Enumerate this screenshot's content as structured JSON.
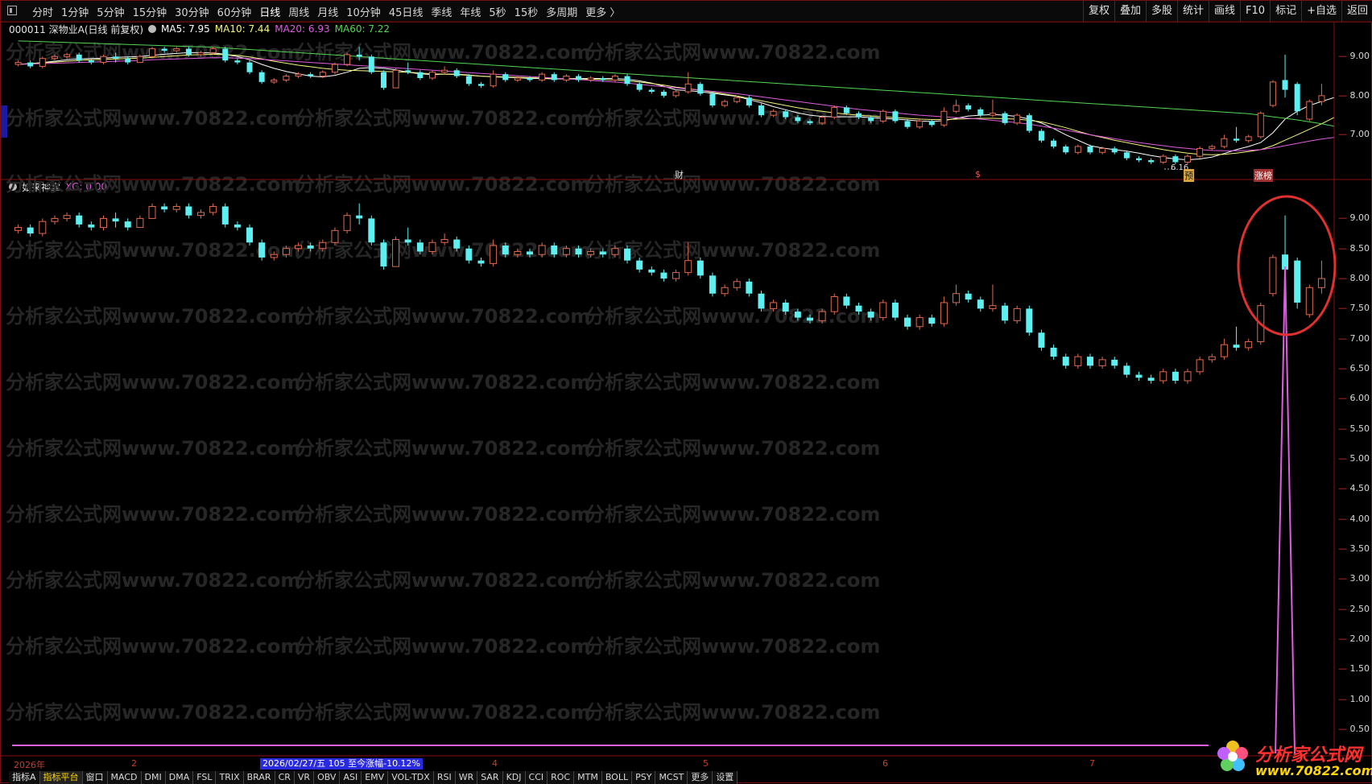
{
  "toolbar": {
    "periods": [
      "分时",
      "1分钟",
      "5分钟",
      "15分钟",
      "30分钟",
      "60分钟",
      "日线",
      "周线",
      "月线",
      "10分钟",
      "45日线",
      "季线",
      "年线",
      "5秒",
      "15秒",
      "多周期",
      "更多 〉"
    ],
    "active_period": "日线",
    "right_tools": [
      "复权",
      "叠加",
      "多股",
      "统计",
      "画线",
      "F10",
      "标记",
      "+自选",
      "返回"
    ]
  },
  "main_panel": {
    "stock": "000011 深物业A(日线 前复权)",
    "ma5_label": "MA5: 7.95",
    "ma10_label": "MA10: 7.44",
    "ma20_label": "MA20: 6.93",
    "ma60_label": "MA60: 7.22",
    "axis_labels": [
      "9.00",
      "8.00",
      "7.00"
    ],
    "markers": {
      "cai": "财",
      "dollar": "$",
      "low_price": "6.16",
      "yu": "预",
      "zhangbang": "涨榜"
    }
  },
  "indicator_panel": {
    "name": "如来神掌",
    "xg_label": "XG: 0.00",
    "axis_labels": [
      "9.00",
      "8.50",
      "8.00",
      "7.50",
      "7.00",
      "6.50",
      "6.00",
      "5.50",
      "5.00",
      "4.50",
      "4.00",
      "3.50",
      "3.00",
      "2.50",
      "2.00",
      "1.50",
      "1.00",
      "0.50"
    ]
  },
  "date_bar": {
    "year": "2026年",
    "month_2": "2",
    "range_label": "2026/02/27/五 105 至今涨幅-10.12%",
    "month_4": "4",
    "month_5": "5",
    "month_6": "6",
    "month_7": "7"
  },
  "indicator_tabs": [
    "指标A",
    "指标平台",
    "窗口",
    "MACD",
    "DMI",
    "DMA",
    "FSL",
    "TRIX",
    "BRAR",
    "CR",
    "VR",
    "OBV",
    "ASI",
    "EMV",
    "VOL-TDX",
    "RSI",
    "WR",
    "SAR",
    "KDJ",
    "CCI",
    "ROC",
    "MTM",
    "BOLL",
    "PSY",
    "MCST",
    "更多",
    "设置"
  ],
  "active_indicator_tab": "指标平台",
  "watermark": "分析家公式网www.70822.com",
  "corner_logo": {
    "brand": "分析家公式网",
    "url": "www.70822.com"
  },
  "colors": {
    "up": "#e06a50",
    "down": "#5ef0f0",
    "ma5": "#ffffff",
    "ma10": "#f5f57a",
    "ma20": "#e05ce0",
    "ma60": "#52d652",
    "axis": "#d33",
    "highlight_circle": "#e03030"
  },
  "chart_data": {
    "type": "candlestick",
    "candles": [
      [
        8.8,
        8.85,
        8.75,
        8.9
      ],
      [
        8.85,
        8.75,
        8.7,
        8.9
      ],
      [
        8.75,
        8.95,
        8.7,
        9.0
      ],
      [
        8.95,
        9.0,
        8.9,
        9.05
      ],
      [
        9.0,
        9.05,
        8.95,
        9.1
      ],
      [
        9.05,
        8.9,
        8.85,
        9.1
      ],
      [
        8.9,
        8.85,
        8.8,
        8.95
      ],
      [
        8.85,
        9.0,
        8.8,
        9.05
      ],
      [
        9.0,
        8.95,
        8.85,
        9.1
      ],
      [
        8.95,
        8.85,
        8.8,
        9.0
      ],
      [
        8.85,
        9.0,
        8.85,
        9.05
      ],
      [
        9.0,
        9.2,
        9.0,
        9.25
      ],
      [
        9.2,
        9.15,
        9.1,
        9.25
      ],
      [
        9.15,
        9.2,
        9.1,
        9.25
      ],
      [
        9.2,
        9.05,
        9.0,
        9.25
      ],
      [
        9.05,
        9.1,
        9.0,
        9.15
      ],
      [
        9.1,
        9.2,
        9.05,
        9.25
      ],
      [
        9.2,
        8.9,
        8.85,
        9.25
      ],
      [
        8.9,
        8.85,
        8.8,
        8.95
      ],
      [
        8.85,
        8.6,
        8.55,
        8.9
      ],
      [
        8.6,
        8.35,
        8.3,
        8.65
      ],
      [
        8.35,
        8.4,
        8.3,
        8.45
      ],
      [
        8.4,
        8.5,
        8.35,
        8.55
      ],
      [
        8.5,
        8.55,
        8.45,
        8.6
      ],
      [
        8.55,
        8.5,
        8.45,
        8.6
      ],
      [
        8.5,
        8.6,
        8.45,
        8.65
      ],
      [
        8.6,
        8.8,
        8.55,
        8.85
      ],
      [
        8.8,
        9.05,
        8.75,
        9.1
      ],
      [
        9.05,
        9.0,
        8.9,
        9.25
      ],
      [
        9.0,
        8.6,
        8.55,
        9.05
      ],
      [
        8.6,
        8.2,
        8.15,
        8.65
      ],
      [
        8.2,
        8.65,
        8.2,
        8.7
      ],
      [
        8.65,
        8.6,
        8.55,
        8.85
      ],
      [
        8.6,
        8.45,
        8.4,
        8.65
      ],
      [
        8.45,
        8.6,
        8.4,
        8.65
      ],
      [
        8.6,
        8.65,
        8.55,
        8.75
      ],
      [
        8.65,
        8.5,
        8.45,
        8.7
      ],
      [
        8.5,
        8.3,
        8.25,
        8.55
      ],
      [
        8.3,
        8.25,
        8.2,
        8.35
      ],
      [
        8.25,
        8.55,
        8.2,
        8.65
      ],
      [
        8.55,
        8.4,
        8.35,
        8.6
      ],
      [
        8.4,
        8.45,
        8.35,
        8.5
      ],
      [
        8.45,
        8.4,
        8.35,
        8.5
      ],
      [
        8.4,
        8.55,
        8.35,
        8.6
      ],
      [
        8.55,
        8.4,
        8.35,
        8.6
      ],
      [
        8.4,
        8.5,
        8.35,
        8.55
      ],
      [
        8.5,
        8.4,
        8.35,
        8.55
      ],
      [
        8.4,
        8.45,
        8.35,
        8.5
      ],
      [
        8.45,
        8.4,
        8.35,
        8.5
      ],
      [
        8.4,
        8.5,
        8.35,
        8.55
      ],
      [
        8.5,
        8.3,
        8.25,
        8.55
      ],
      [
        8.3,
        8.15,
        8.1,
        8.35
      ],
      [
        8.15,
        8.1,
        8.05,
        8.2
      ],
      [
        8.1,
        8.0,
        7.95,
        8.15
      ],
      [
        8.0,
        8.1,
        7.95,
        8.15
      ],
      [
        8.1,
        8.3,
        8.05,
        8.6
      ],
      [
        8.3,
        8.05,
        8.0,
        8.35
      ],
      [
        8.05,
        7.75,
        7.7,
        8.1
      ],
      [
        7.75,
        7.85,
        7.7,
        7.9
      ],
      [
        7.85,
        7.95,
        7.8,
        8.0
      ],
      [
        7.95,
        7.75,
        7.7,
        8.0
      ],
      [
        7.75,
        7.5,
        7.45,
        7.8
      ],
      [
        7.5,
        7.6,
        7.45,
        7.65
      ],
      [
        7.6,
        7.45,
        7.4,
        7.65
      ],
      [
        7.45,
        7.35,
        7.3,
        7.5
      ],
      [
        7.35,
        7.3,
        7.25,
        7.4
      ],
      [
        7.3,
        7.45,
        7.25,
        7.5
      ],
      [
        7.45,
        7.7,
        7.4,
        7.75
      ],
      [
        7.7,
        7.55,
        7.5,
        7.75
      ],
      [
        7.55,
        7.45,
        7.4,
        7.6
      ],
      [
        7.45,
        7.35,
        7.3,
        7.5
      ],
      [
        7.35,
        7.6,
        7.3,
        7.65
      ],
      [
        7.6,
        7.35,
        7.3,
        7.65
      ],
      [
        7.35,
        7.2,
        7.15,
        7.4
      ],
      [
        7.2,
        7.35,
        7.15,
        7.4
      ],
      [
        7.35,
        7.25,
        7.2,
        7.4
      ],
      [
        7.25,
        7.6,
        7.2,
        7.7
      ],
      [
        7.6,
        7.75,
        7.55,
        7.9
      ],
      [
        7.75,
        7.65,
        7.6,
        7.8
      ],
      [
        7.65,
        7.5,
        7.45,
        7.7
      ],
      [
        7.5,
        7.55,
        7.45,
        7.9
      ],
      [
        7.55,
        7.3,
        7.25,
        7.6
      ],
      [
        7.3,
        7.5,
        7.25,
        7.55
      ],
      [
        7.5,
        7.1,
        7.05,
        7.55
      ],
      [
        7.1,
        6.85,
        6.8,
        7.15
      ],
      [
        6.85,
        6.7,
        6.65,
        6.9
      ],
      [
        6.7,
        6.55,
        6.5,
        6.75
      ],
      [
        6.55,
        6.7,
        6.5,
        6.75
      ],
      [
        6.7,
        6.55,
        6.5,
        6.75
      ],
      [
        6.55,
        6.65,
        6.5,
        6.7
      ],
      [
        6.65,
        6.55,
        6.5,
        6.7
      ],
      [
        6.55,
        6.4,
        6.35,
        6.6
      ],
      [
        6.4,
        6.35,
        6.3,
        6.45
      ],
      [
        6.35,
        6.3,
        6.25,
        6.4
      ],
      [
        6.3,
        6.45,
        6.25,
        6.5
      ],
      [
        6.45,
        6.3,
        6.25,
        6.5
      ],
      [
        6.3,
        6.45,
        6.25,
        6.5
      ],
      [
        6.45,
        6.65,
        6.4,
        6.7
      ],
      [
        6.65,
        6.7,
        6.6,
        6.75
      ],
      [
        6.7,
        6.9,
        6.65,
        7.0
      ],
      [
        6.9,
        6.85,
        6.8,
        7.2
      ],
      [
        6.85,
        6.95,
        6.8,
        7.0
      ],
      [
        6.95,
        7.55,
        6.9,
        7.6
      ],
      [
        7.75,
        8.35,
        7.7,
        8.4
      ],
      [
        8.4,
        8.15,
        7.95,
        9.05
      ],
      [
        8.3,
        7.6,
        7.5,
        8.35
      ],
      [
        7.4,
        7.85,
        7.35,
        7.9
      ],
      [
        7.85,
        8.0,
        7.75,
        8.3
      ]
    ],
    "ma_series": [
      {
        "name": "MA5",
        "values": [
          8.8,
          8.82,
          8.85,
          8.88,
          8.92,
          8.94,
          8.95,
          8.96,
          8.98,
          8.99,
          9.0,
          9.03,
          9.06,
          9.08,
          9.1,
          9.1,
          9.09,
          9.06,
          9.0,
          8.92,
          8.8,
          8.7,
          8.62,
          8.56,
          8.5,
          8.48,
          8.52,
          8.6,
          8.7,
          8.72,
          8.7,
          8.66,
          8.6,
          8.56,
          8.54,
          8.55,
          8.55,
          8.53,
          8.5,
          8.48,
          8.47,
          8.46,
          8.44,
          8.44,
          8.43,
          8.43,
          8.44,
          8.44,
          8.44,
          8.44,
          8.42,
          8.38,
          8.32,
          8.24,
          8.15,
          8.13,
          8.1,
          8.06,
          8.02,
          7.98,
          7.9,
          7.82,
          7.72,
          7.64,
          7.56,
          7.5,
          7.47,
          7.46,
          7.46,
          7.46,
          7.44,
          7.42,
          7.4,
          7.38,
          7.35,
          7.34,
          7.36,
          7.42,
          7.48,
          7.5,
          7.52,
          7.5,
          7.47,
          7.4,
          7.3,
          7.16,
          7.0,
          6.86,
          6.72,
          6.66,
          6.62,
          6.58,
          6.53,
          6.47,
          6.42,
          6.38,
          6.36,
          6.38,
          6.43,
          6.52,
          6.62,
          6.7,
          6.8,
          7.05,
          7.4,
          7.6,
          7.75,
          7.85,
          7.95
        ]
      },
      {
        "name": "MA10",
        "values": [
          8.8,
          8.82,
          8.84,
          8.86,
          8.88,
          8.9,
          8.92,
          8.93,
          8.94,
          8.95,
          8.96,
          8.98,
          9.0,
          9.02,
          9.04,
          9.05,
          9.06,
          9.05,
          9.03,
          8.99,
          8.94,
          8.88,
          8.83,
          8.78,
          8.74,
          8.7,
          8.67,
          8.65,
          8.64,
          8.63,
          8.62,
          8.61,
          8.6,
          8.58,
          8.56,
          8.55,
          8.54,
          8.52,
          8.5,
          8.49,
          8.48,
          8.47,
          8.46,
          8.45,
          8.44,
          8.44,
          8.43,
          8.42,
          8.41,
          8.4,
          8.38,
          8.35,
          8.31,
          8.27,
          8.22,
          8.18,
          8.14,
          8.09,
          8.04,
          7.99,
          7.93,
          7.87,
          7.81,
          7.75,
          7.69,
          7.64,
          7.6,
          7.56,
          7.53,
          7.5,
          7.48,
          7.46,
          7.44,
          7.42,
          7.4,
          7.39,
          7.39,
          7.4,
          7.41,
          7.42,
          7.42,
          7.41,
          7.4,
          7.37,
          7.33,
          7.26,
          7.18,
          7.09,
          7.0,
          6.93,
          6.86,
          6.8,
          6.74,
          6.68,
          6.62,
          6.57,
          6.53,
          6.5,
          6.49,
          6.5,
          6.53,
          6.57,
          6.62,
          6.72,
          6.86,
          7.0,
          7.14,
          7.28,
          7.44
        ]
      },
      {
        "name": "MA20",
        "values": [
          8.8,
          8.81,
          8.82,
          8.83,
          8.84,
          8.85,
          8.86,
          8.87,
          8.88,
          8.89,
          8.9,
          8.92,
          8.93,
          8.94,
          8.95,
          8.96,
          8.97,
          8.97,
          8.96,
          8.95,
          8.93,
          8.91,
          8.89,
          8.87,
          8.85,
          8.83,
          8.81,
          8.79,
          8.77,
          8.75,
          8.73,
          8.71,
          8.69,
          8.67,
          8.65,
          8.63,
          8.61,
          8.59,
          8.57,
          8.55,
          8.53,
          8.51,
          8.49,
          8.47,
          8.45,
          8.43,
          8.41,
          8.39,
          8.37,
          8.35,
          8.32,
          8.29,
          8.26,
          8.23,
          8.2,
          8.17,
          8.14,
          8.11,
          8.08,
          8.05,
          8.01,
          7.97,
          7.93,
          7.89,
          7.85,
          7.81,
          7.77,
          7.73,
          7.69,
          7.65,
          7.62,
          7.59,
          7.56,
          7.53,
          7.5,
          7.48,
          7.46,
          7.44,
          7.42,
          7.4,
          7.37,
          7.34,
          7.31,
          7.27,
          7.22,
          7.17,
          7.12,
          7.06,
          7.0,
          6.95,
          6.9,
          6.85,
          6.8,
          6.76,
          6.72,
          6.68,
          6.65,
          6.62,
          6.6,
          6.59,
          6.59,
          6.6,
          6.62,
          6.66,
          6.72,
          6.78,
          6.84,
          6.89,
          6.93
        ]
      },
      {
        "name": "MA60",
        "values": [
          9.4,
          9.39,
          9.38,
          9.37,
          9.36,
          9.35,
          9.34,
          9.33,
          9.32,
          9.31,
          9.3,
          9.29,
          9.28,
          9.27,
          9.26,
          9.25,
          9.24,
          9.22,
          9.2,
          9.18,
          9.16,
          9.14,
          9.12,
          9.1,
          9.08,
          9.06,
          9.04,
          9.02,
          9.0,
          8.98,
          8.96,
          8.94,
          8.92,
          8.9,
          8.88,
          8.86,
          8.84,
          8.82,
          8.8,
          8.78,
          8.76,
          8.74,
          8.72,
          8.7,
          8.68,
          8.66,
          8.64,
          8.62,
          8.6,
          8.58,
          8.56,
          8.54,
          8.52,
          8.5,
          8.48,
          8.46,
          8.44,
          8.42,
          8.4,
          8.38,
          8.36,
          8.34,
          8.32,
          8.3,
          8.28,
          8.26,
          8.24,
          8.22,
          8.2,
          8.18,
          8.16,
          8.14,
          8.12,
          8.1,
          8.08,
          8.06,
          8.04,
          8.02,
          8.0,
          7.98,
          7.96,
          7.94,
          7.92,
          7.9,
          7.88,
          7.86,
          7.84,
          7.82,
          7.8,
          7.78,
          7.76,
          7.74,
          7.72,
          7.7,
          7.68,
          7.66,
          7.64,
          7.62,
          7.6,
          7.58,
          7.56,
          7.54,
          7.5,
          7.46,
          7.42,
          7.38,
          7.33,
          7.28,
          7.22
        ]
      }
    ],
    "main_ylim": [
      6.0,
      9.5
    ],
    "indicator_ylim": [
      0.3,
      9.3
    ],
    "xg_line_value": 0.0
  }
}
